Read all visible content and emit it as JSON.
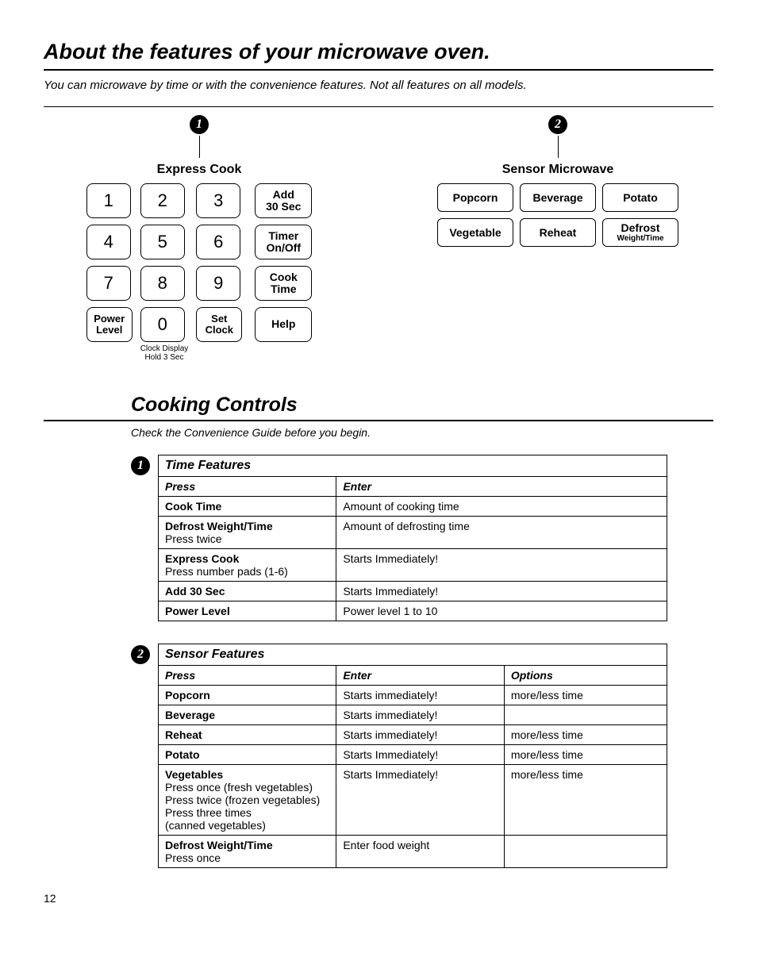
{
  "page": {
    "number": "12"
  },
  "header": {
    "title": "About the features of your microwave oven.",
    "intro": "You can microwave by time or with the convenience features.  Not all features on all models."
  },
  "panel1": {
    "num": "1",
    "title": "Express Cook",
    "keys": {
      "k1": "1",
      "k2": "2",
      "k3": "3",
      "k4": "4",
      "k5": "5",
      "k6": "6",
      "k7": "7",
      "k8": "8",
      "k9": "9",
      "k0": "0",
      "power_l1": "Power",
      "power_l2": "Level",
      "set_l1": "Set",
      "set_l2": "Clock",
      "add_l1": "Add",
      "add_l2": "30 Sec",
      "timer_l1": "Timer",
      "timer_l2": "On/Off",
      "cook_l1": "Cook",
      "cook_l2": "Time",
      "help": "Help"
    },
    "sub_l1": "Clock Display",
    "sub_l2": "Hold 3 Sec"
  },
  "panel2": {
    "num": "2",
    "title": "Sensor Microwave",
    "keys": {
      "popcorn": "Popcorn",
      "beverage": "Beverage",
      "potato": "Potato",
      "vegetable": "Vegetable",
      "reheat": "Reheat",
      "defrost_l1": "Defrost",
      "defrost_l2": "Weight/Time"
    }
  },
  "section2": {
    "title": "Cooking Controls",
    "check": "Check the Convenience Guide before you begin."
  },
  "table1": {
    "num": "1",
    "header": "Time Features",
    "col1": "Press",
    "col2": "Enter",
    "r1a": "Cook Time",
    "r1b": "Amount of cooking time",
    "r2a": "Defrost Weight/Time",
    "r2a2": "Press twice",
    "r2b": "Amount of defrosting time",
    "r3a": "Express Cook",
    "r3a2": "Press number pads (1-6)",
    "r3b": "Starts Immediately!",
    "r4a": "Add 30 Sec",
    "r4b": "Starts Immediately!",
    "r5a": "Power Level",
    "r5b": "Power level 1 to 10"
  },
  "table2": {
    "num": "2",
    "header": "Sensor Features",
    "col1": "Press",
    "col2": "Enter",
    "col3": "Options",
    "r1a": "Popcorn",
    "r1b": "Starts immediately!",
    "r1c": "more/less time",
    "r2a": "Beverage",
    "r2b": "Starts immediately!",
    "r2c": "",
    "r3a": "Reheat",
    "r3b": "Starts immediately!",
    "r3c": "more/less time",
    "r4a": "Potato",
    "r4b": "Starts Immediately!",
    "r4c": "more/less time",
    "r5a": "Vegetables",
    "r5a2": "Press once (fresh vegetables)",
    "r5a3": "Press twice (frozen vegetables)",
    "r5a4": "Press three times",
    "r5a5": "(canned vegetables)",
    "r5b": "Starts Immediately!",
    "r5c": "more/less time",
    "r6a": "Defrost Weight/Time",
    "r6a2": "Press once",
    "r6b": "Enter food weight",
    "r6c": ""
  }
}
